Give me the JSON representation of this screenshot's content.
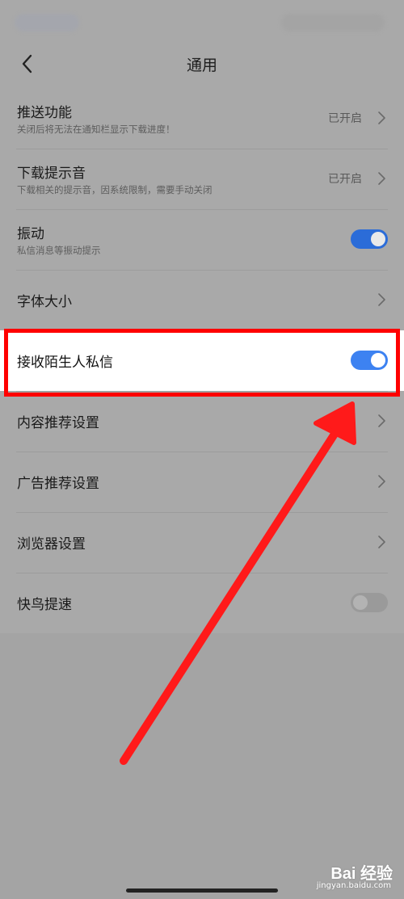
{
  "header": {
    "title": "通用"
  },
  "rows": [
    {
      "title": "推送功能",
      "subtitle": "关闭后将无法在通知栏显示下载进度！",
      "value": "已开启"
    },
    {
      "title": "下载提示音",
      "subtitle": "下载相关的提示音，因系统限制，需要手动关闭",
      "value": "已开启"
    },
    {
      "title": "振动",
      "subtitle": "私信消息等振动提示",
      "toggle": "on"
    },
    {
      "title": "字体大小"
    },
    {
      "title": "接收陌生人私信",
      "toggle": "on"
    },
    {
      "title": "内容推荐设置"
    },
    {
      "title": "广告推荐设置"
    },
    {
      "title": "浏览器设置"
    },
    {
      "title": "快鸟提速",
      "toggle": "off"
    }
  ],
  "watermark": {
    "logo": "Bai 经验",
    "url": "jingyan.baidu.com"
  },
  "colors": {
    "toggle_on": "#3d82f1",
    "highlight_border": "#ff0000",
    "dim_background": "#a9a9a9"
  }
}
